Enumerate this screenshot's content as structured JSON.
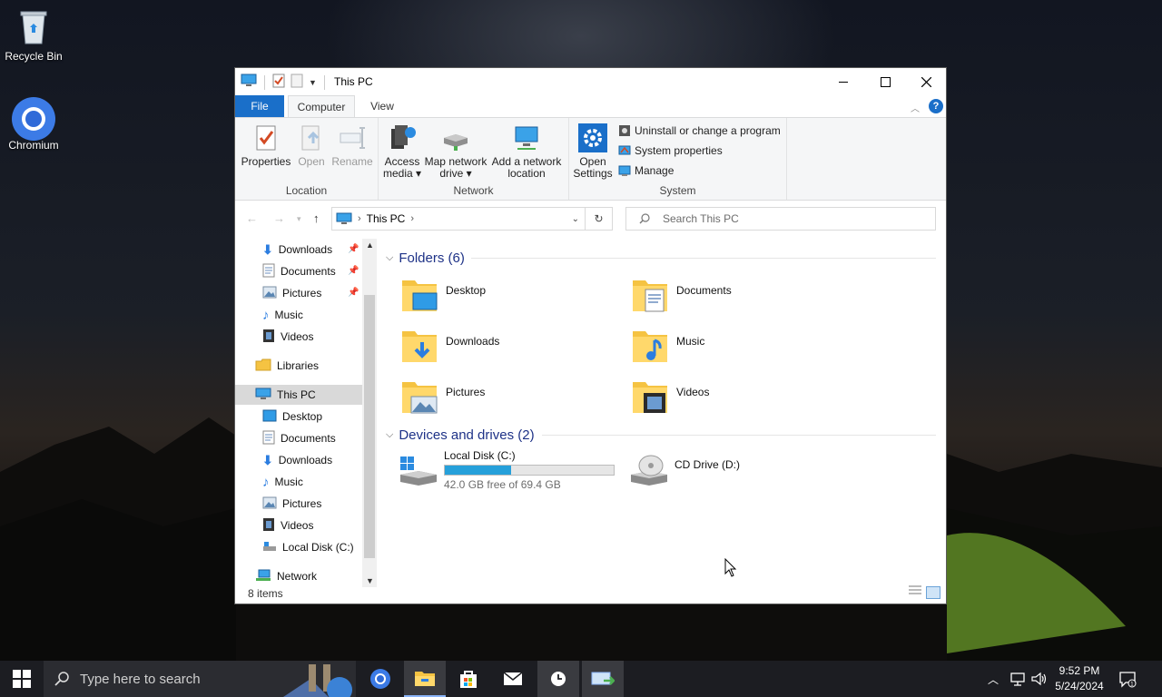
{
  "desktop": {
    "icons": [
      {
        "label": "Recycle Bin",
        "icon": "recycle-bin-icon"
      },
      {
        "label": "Chromium",
        "icon": "chromium-icon"
      }
    ]
  },
  "window": {
    "title": "This PC",
    "controls": {
      "minimize": "minimize-icon",
      "maximize": "maximize-icon",
      "close": "close-icon"
    },
    "tabs": {
      "file": "File",
      "computer": "Computer",
      "view": "View"
    },
    "ribbon": {
      "location": {
        "group_label": "Location",
        "properties": "Properties",
        "open": "Open",
        "rename": "Rename"
      },
      "network": {
        "group_label": "Network",
        "access_media_1": "Access",
        "access_media_2": "media ▾",
        "map_drive_1": "Map network",
        "map_drive_2": "drive ▾",
        "add_location_1": "Add a network",
        "add_location_2": "location"
      },
      "system": {
        "group_label": "System",
        "open_settings_1": "Open",
        "open_settings_2": "Settings",
        "uninstall": "Uninstall or change a program",
        "system_properties": "System properties",
        "manage": "Manage"
      }
    },
    "address": {
      "path": "This PC",
      "search_placeholder": "Search This PC"
    },
    "nav": {
      "quick_access": [
        {
          "label": "Downloads",
          "pinned": true
        },
        {
          "label": "Documents",
          "pinned": true
        },
        {
          "label": "Pictures",
          "pinned": true
        },
        {
          "label": "Music",
          "pinned": false
        },
        {
          "label": "Videos",
          "pinned": false
        }
      ],
      "libraries": "Libraries",
      "this_pc": "This PC",
      "this_pc_children": [
        "Desktop",
        "Documents",
        "Downloads",
        "Music",
        "Pictures",
        "Videos",
        "Local Disk (C:)"
      ],
      "network": "Network"
    },
    "content": {
      "folders_header": "Folders (6)",
      "folders": [
        "Desktop",
        "Documents",
        "Downloads",
        "Music",
        "Pictures",
        "Videos"
      ],
      "drives_header": "Devices and drives (2)",
      "drives": [
        {
          "name": "Local Disk (C:)",
          "free": "42.0 GB free of 69.4 GB",
          "used_fraction": 0.395
        },
        {
          "name": "CD Drive (D:)"
        }
      ]
    },
    "status": "8 items"
  },
  "taskbar": {
    "search_placeholder": "Type here to search",
    "time": "9:52 PM",
    "date": "5/24/2024"
  },
  "colors": {
    "accent": "#1a6fc9",
    "drive_bar": "#26a0da",
    "section_header": "#1e3287",
    "folder_yellow": "#f5c342"
  }
}
